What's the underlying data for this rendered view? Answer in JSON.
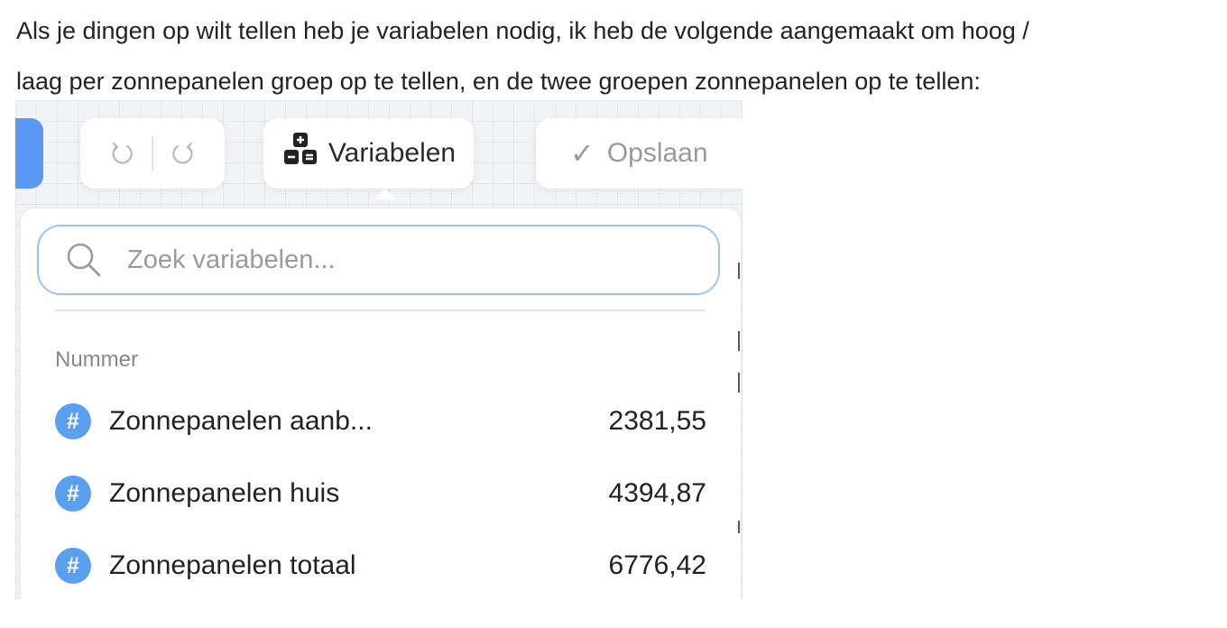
{
  "intro": {
    "line1": "Als je dingen op wilt tellen heb je variabelen nodig, ik heb de volgende aangemaakt om hoog /",
    "line2": "laag per zonnepanelen groep op te tellen, en de twee groepen zonnepanelen op te tellen:"
  },
  "toolbar": {
    "variables_label": "Variabelen",
    "save_label": "Opslaan",
    "accent_color": "#5b97f5"
  },
  "popover": {
    "search_placeholder": "Zoek variabelen...",
    "section_label": "Nummer",
    "variables": [
      {
        "icon": "#",
        "name": "Zonnepanelen aanb...",
        "value": "2381,55"
      },
      {
        "icon": "#",
        "name": "Zonnepanelen huis",
        "value": "4394,87"
      },
      {
        "icon": "#",
        "name": "Zonnepanelen totaal",
        "value": "6776,42"
      }
    ],
    "badge_color": "#5b9ff0"
  }
}
